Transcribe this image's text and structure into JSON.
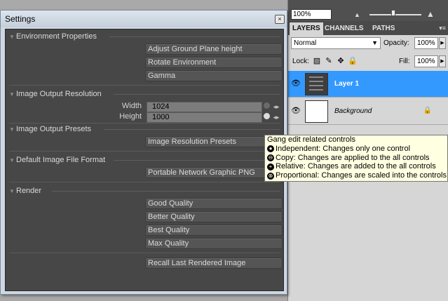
{
  "layers_panel": {
    "zoom": "100%",
    "tabs": [
      "LAYERS",
      "CHANNELS",
      "PATHS"
    ],
    "blend_mode": "Normal",
    "opacity_label": "Opacity:",
    "opacity_value": "100%",
    "lock_label": "Lock:",
    "fill_label": "Fill:",
    "fill_value": "100%",
    "layers": [
      {
        "name": "Layer 1",
        "selected": true
      },
      {
        "name": "Background",
        "selected": false
      }
    ]
  },
  "settings": {
    "title": "Settings",
    "close_glyph": "×",
    "sections": {
      "environment": {
        "title": "Environment Properties",
        "buttons": [
          "Adjust Ground Plane height",
          "Rotate Environment",
          "Gamma"
        ]
      },
      "resolution": {
        "title": "Image Output Resolution",
        "width_label": "Width",
        "width_value": "1024",
        "height_label": "Height",
        "height_value": "1000"
      },
      "presets": {
        "title": "Image Output Presets",
        "button": "Image Resolution Presets"
      },
      "format": {
        "title": "Default Image File Format",
        "button": "Portable Network Graphic PNG"
      },
      "render": {
        "title": "Render",
        "buttons": [
          "Good Quality",
          "Better Quality",
          "Best Quality",
          "Max Quality"
        ],
        "recall_button": "Recall Last Rendered Image"
      }
    }
  },
  "tooltip": {
    "title": "Gang edit related controls",
    "lines": [
      "Independent: Changes only one control",
      "Copy: Changes are applied to the all controls",
      "Relative:  Changes are added to the all controls",
      "Proportional: Changes are scaled into the controls"
    ]
  }
}
